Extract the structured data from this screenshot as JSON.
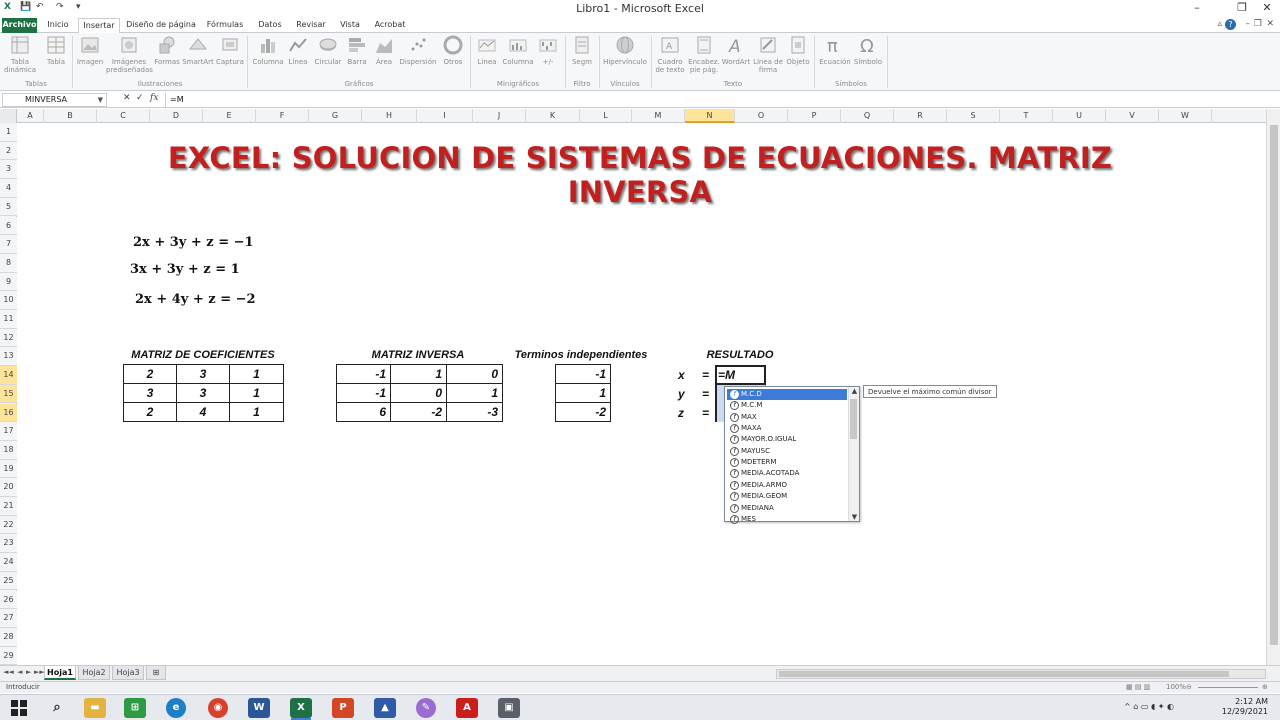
{
  "window": {
    "title": "Libro1  -  Microsoft Excel",
    "minimize": "–",
    "restore": "❐",
    "close": "✕"
  },
  "quick_access": [
    "X",
    "💾",
    "↶",
    "↷",
    "▾"
  ],
  "ribbon_tabs": [
    "Archivo",
    "Inicio",
    "Insertar",
    "Diseño de página",
    "Fórmulas",
    "Datos",
    "Revisar",
    "Vista",
    "Acrobat"
  ],
  "ribbon_groups": {
    "tablas": {
      "label": "Tablas",
      "buttons": [
        "Tabla dinámica",
        "Tabla"
      ]
    },
    "ilustraciones": {
      "label": "Ilustraciones",
      "buttons": [
        "Imagen",
        "Imágenes prediseñadas",
        "Formas",
        "SmartArt",
        "Captura"
      ]
    },
    "graficos": {
      "label": "Gráficos",
      "buttons": [
        "Columna",
        "Línea",
        "Circular",
        "Barra",
        "Área",
        "Dispersión",
        "Otros"
      ]
    },
    "minigraficos": {
      "label": "Minigráficos",
      "buttons": [
        "Línea",
        "Columna",
        "+/-"
      ]
    },
    "filtro": {
      "label": "Filtro",
      "buttons": [
        "Segm"
      ]
    },
    "vinculos": {
      "label": "Vínculos",
      "buttons": [
        "Hipervínculo"
      ]
    },
    "texto": {
      "label": "Texto",
      "buttons": [
        "Cuadro de texto",
        "Encabez. pie pág.",
        "WordArt",
        "Línea de firma",
        "Objeto"
      ]
    },
    "simbolos": {
      "label": "Símbolos",
      "buttons": [
        "Ecuación",
        "Símbolo"
      ]
    }
  },
  "formula_bar": {
    "name_box": "MINVERSA",
    "cancel": "✕",
    "enter": "✓",
    "fx": "fx",
    "formula": "=M"
  },
  "columns": [
    "A",
    "B",
    "C",
    "D",
    "E",
    "F",
    "G",
    "H",
    "I",
    "J",
    "K",
    "L",
    "M",
    "N",
    "O",
    "P",
    "Q",
    "R",
    "S",
    "T",
    "U",
    "V",
    "W"
  ],
  "rows": [
    "1",
    "2",
    "3",
    "4",
    "5",
    "6",
    "7",
    "8",
    "9",
    "10",
    "11",
    "12",
    "13",
    "14",
    "15",
    "16",
    "17",
    "18",
    "19",
    "20",
    "21",
    "22",
    "23",
    "24",
    "25",
    "26",
    "27",
    "28",
    "29"
  ],
  "selected_column": "N",
  "selected_rows": [
    "14",
    "15",
    "16"
  ],
  "sheet": {
    "title": "EXCEL: SOLUCION DE SISTEMAS DE ECUACIONES. MATRIZ INVERSA",
    "title_color": "#c21f1f",
    "equations": [
      "2x + 3y + z = −1",
      "3x + 3y + z = 1",
      "2x + 4y + z = −2"
    ],
    "headers": {
      "coef": "MATRIZ DE COEFICIENTES",
      "inversa": "MATRIZ INVERSA",
      "terminos": "Terminos independientes",
      "resultado": "RESULTADO"
    },
    "coef_matrix": [
      [
        "2",
        "3",
        "1"
      ],
      [
        "3",
        "3",
        "1"
      ],
      [
        "2",
        "4",
        "1"
      ]
    ],
    "inverse_matrix": [
      [
        "-1",
        "1",
        "0"
      ],
      [
        "-1",
        "0",
        "1"
      ],
      [
        "6",
        "-2",
        "-3"
      ]
    ],
    "independent_terms": [
      "-1",
      "1",
      "-2"
    ],
    "variables": [
      "x",
      "y",
      "z"
    ],
    "equals": "=",
    "active_cell_text": "=M"
  },
  "autocomplete": {
    "items": [
      "M.C.D",
      "M.C.M",
      "MAX",
      "MAXA",
      "MAYOR.O.IGUAL",
      "MAYUSC",
      "MDETERM",
      "MEDIA.ACOTADA",
      "MEDIA.ARMO",
      "MEDIA.GEOM",
      "MEDIANA",
      "MES"
    ],
    "selected_index": 0,
    "tooltip": "Devuelve el máximo común divisor"
  },
  "sheet_tabs": [
    "Hoja1",
    "Hoja2",
    "Hoja3"
  ],
  "active_sheet": "Hoja1",
  "status": {
    "mode": "Introducir",
    "zoom": "100%"
  },
  "taskbar": {
    "time": "2:12 AM",
    "date": "12/29/2021"
  },
  "colors": {
    "excel_green": "#1e7145",
    "selection_header": "#fde49a",
    "autocomplete_highlight": "#3d7bd9"
  }
}
